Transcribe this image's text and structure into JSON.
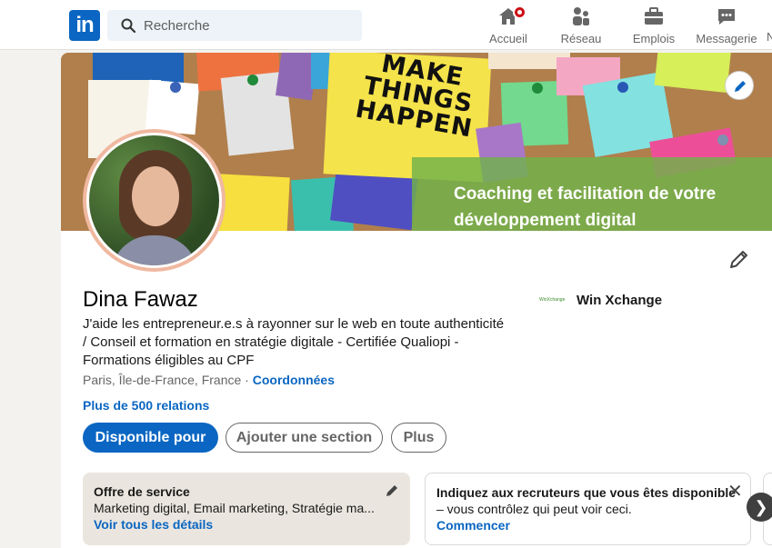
{
  "nav": {
    "logo": "in",
    "search_placeholder": "Recherche",
    "items": [
      {
        "label": "Accueil",
        "icon": "home-icon"
      },
      {
        "label": "Réseau",
        "icon": "network-icon"
      },
      {
        "label": "Emplois",
        "icon": "briefcase-icon"
      },
      {
        "label": "Messagerie",
        "icon": "messaging-icon"
      }
    ],
    "cut_label": "N"
  },
  "banner": {
    "sticky_text": "MAKE THINGS HAPPEN",
    "tagline": "Coaching et facilitation de votre développement digital"
  },
  "profile": {
    "name": "Dina Fawaz",
    "headline": "J'aide les entrepreneur.e.s à rayonner sur le web en toute authenticité / Conseil et formation en stratégie digitale - Certifiée Qualiopi - Formations éligibles au CPF",
    "location": "Paris, Île-de-France, France",
    "separator": " · ",
    "contact_link": "Coordonnées",
    "relations": "Plus de 500 relations",
    "company": {
      "logo_text": "WinXchange",
      "name": "Win Xchange"
    }
  },
  "actions": {
    "primary": "Disponible pour",
    "add_section": "Ajouter une section",
    "more": "Plus"
  },
  "offer_card": {
    "title": "Offre de service",
    "description": "Marketing digital, Email marketing, Stratégie ma...",
    "link": "Voir tous les détails"
  },
  "recruiter_card": {
    "title": "Indiquez aux recruteurs que vous êtes disponible",
    "description": "– vous contrôlez qui peut voir ceci.",
    "link": "Commencer",
    "close": "✕"
  },
  "carousel": {
    "next": "❯"
  },
  "colors": {
    "brand": "#0a66c2",
    "banner_overlay": "#70b24a",
    "badge": "#cc1016"
  }
}
